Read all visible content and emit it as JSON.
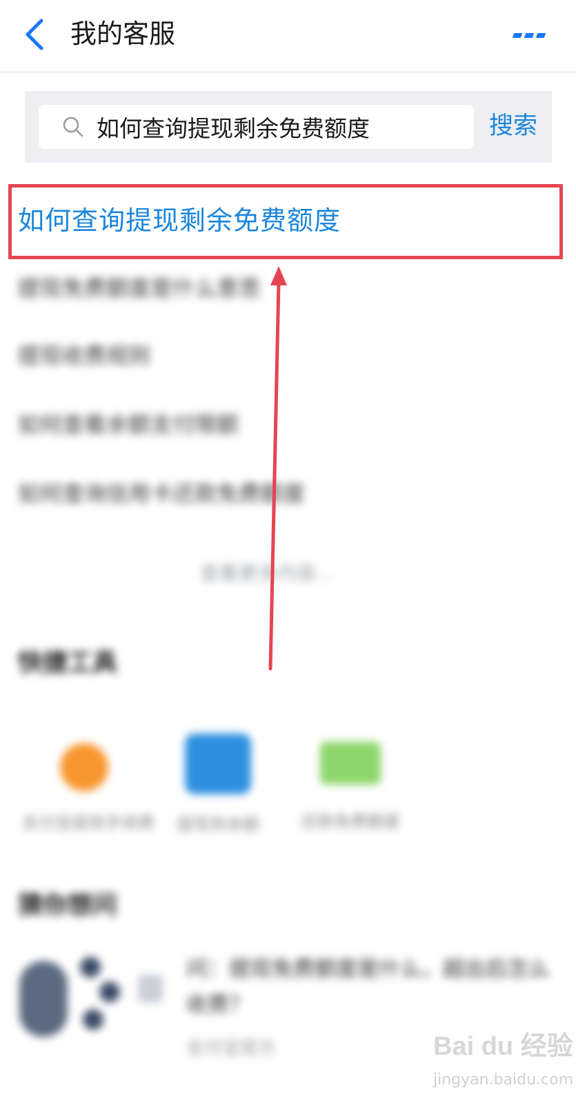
{
  "header": {
    "title": "我的客服",
    "back_icon": "chevron-left-icon",
    "more_icon": "more-dots-icon",
    "accent": "#1677ff"
  },
  "search": {
    "value": "如何查询提现剩余免费额度",
    "button_label": "搜索",
    "icon": "search-icon"
  },
  "results": {
    "highlighted": "如何查询提现剩余免费额度",
    "highlight_color": "#e44552",
    "link_color": "#1b86dc",
    "items": [
      "提现免费额度是什么意思",
      "提现收费规则",
      "如何查看余额支付限额",
      "如何查询信用卡还款免费额度"
    ],
    "more_label": "查看更多内容..."
  },
  "tools": {
    "title": "快捷工具",
    "items": [
      {
        "label": "支付宝提现手续费",
        "icon": "orange-circle-icon",
        "color": "#f7962f"
      },
      {
        "label": "提现到余额",
        "icon": "transfer-card-icon",
        "color": "#2d8fe0"
      },
      {
        "label": "还款免费额度",
        "icon": "green-ticket-icon",
        "color": "#8dd66b"
      }
    ]
  },
  "recommend": {
    "title": "猜你想问",
    "question": "问：提现免费额度是什么，超出后怎么收费？",
    "meta": "支付宝官方"
  },
  "watermark": {
    "brand": "Bai du 经验",
    "url": "jingyan.baidu.com"
  }
}
